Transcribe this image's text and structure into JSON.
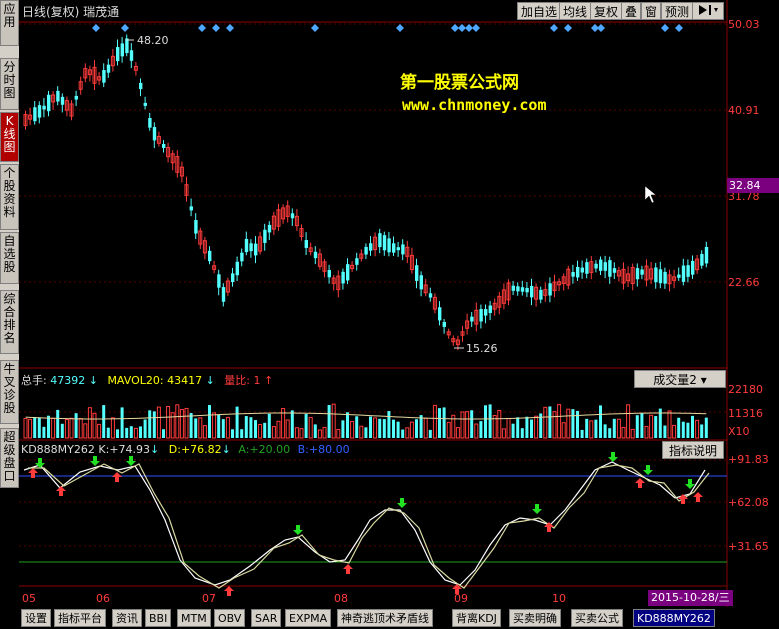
{
  "sidebar": {
    "items": [
      {
        "label": "应用"
      },
      {
        "label": "分时图"
      },
      {
        "label": "K线图"
      },
      {
        "label": "个股资料"
      },
      {
        "label": "自选股"
      },
      {
        "label": "综合排名"
      },
      {
        "label": "牛叉诊股"
      },
      {
        "label": "超级盘口"
      }
    ]
  },
  "header": {
    "title": "日线(复权)  瑞茂通",
    "buttons": [
      "加自选",
      "均线",
      "复权",
      "叠",
      "窗",
      "预测"
    ],
    "nav_icon": "play-pause-icon"
  },
  "watermark": {
    "line1": "第一股票公式网",
    "line2": "www.chnmoney.com"
  },
  "price_axis": {
    "labels": [
      "50.03",
      "40.91",
      "31.78",
      "22.66"
    ],
    "current_price": "32.84",
    "high_marker": "48.20",
    "low_marker": "15.26"
  },
  "volume_panel": {
    "label_total": "总手:",
    "total_value": "47392",
    "label_mavol": "MAVOL20:",
    "mavol_value": "43417",
    "label_ratio": "量比:",
    "ratio_value": "1",
    "button": "成交量2",
    "axis": [
      "22180",
      "11316",
      "X10"
    ]
  },
  "indicator_panel": {
    "name": "KD888MY262",
    "k_label": "K:",
    "k_value": "+74.93",
    "d_label": "D:",
    "d_value": "+76.82",
    "a_label": "A:",
    "a_value": "+20.00",
    "b_label": "B:",
    "b_value": "+80.00",
    "button": "指标说明",
    "axis": [
      "+91.83",
      "+62.08",
      "+31.65"
    ]
  },
  "x_axis": {
    "labels": [
      "05",
      "06",
      "07",
      "08",
      "09",
      "10"
    ],
    "date_badge": "2015-10-28/三"
  },
  "tabs": [
    "设置",
    "指标平台",
    "资讯",
    "BBI",
    "MTM",
    "OBV",
    "SAR",
    "EXPMA",
    "神奇逃顶术矛盾线",
    "背离KDJ",
    "买卖明确",
    "买卖公式",
    "KD888MY262"
  ],
  "colors": {
    "up": "#ff3b3b",
    "down": "#54ffff",
    "accent": "#ffff00",
    "panel_line": "#8b0000"
  }
}
